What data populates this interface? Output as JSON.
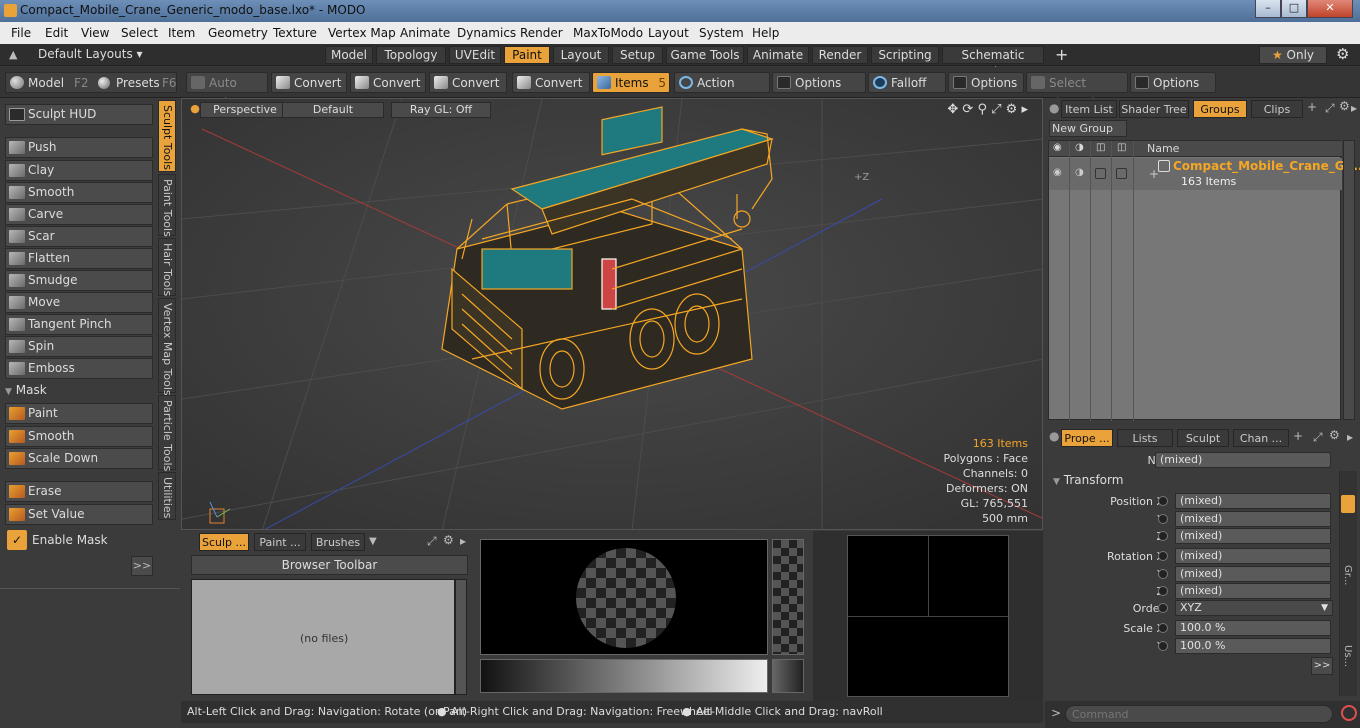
{
  "window": {
    "title": "Compact_Mobile_Crane_Generic_modo_base.lxo* - MODO"
  },
  "menu": [
    "File",
    "Edit",
    "View",
    "Select",
    "Item",
    "Geometry",
    "Texture",
    "Vertex Map",
    "Animate",
    "Dynamics",
    "Render",
    "MaxToModo",
    "Layout",
    "System",
    "Help"
  ],
  "layouts": {
    "label": "Default Layouts",
    "tabs": [
      "Model",
      "Topology",
      "UVEdit",
      "Paint",
      "Layout",
      "Setup",
      "Game Tools",
      "Animate",
      "Render",
      "Scripting",
      "Schematic Fusion"
    ],
    "active": "Paint",
    "only": "Only",
    "plus": "+"
  },
  "toolbar": {
    "model": "Model",
    "model_key": "F2",
    "presets": "Presets",
    "presets_key": "F6",
    "auto_select": "Auto Select",
    "convert1": "Convert",
    "convert2": "Convert",
    "convert3": "Convert",
    "convert4": "Convert",
    "items": "Items",
    "items_num": "5",
    "action_center": "Action Center",
    "options1": "Options",
    "falloff": "Falloff",
    "options2": "Options",
    "select_through": "Select Through",
    "options3": "Options"
  },
  "left": {
    "sculpt_hud": "Sculpt HUD",
    "tools": [
      "Push",
      "Clay",
      "Smooth",
      "Carve",
      "Scar",
      "Flatten",
      "Smudge",
      "Move",
      "Tangent Pinch",
      "Spin",
      "Emboss"
    ],
    "mask_header": "Mask",
    "mask_tools": [
      "Paint",
      "Smooth",
      "Scale Down"
    ],
    "erase": "Erase",
    "set_value": "Set Value",
    "enable_mask": "Enable Mask",
    "more": ">>",
    "vtabs": [
      "Sculpt Tools",
      "Paint Tools",
      "Hair Tools",
      "Vertex Map Tools",
      "Particle Tools",
      "Utilities"
    ]
  },
  "viewport": {
    "perspective": "Perspective",
    "default": "Default",
    "raygl": "Ray GL: Off",
    "axis_label": "+Z",
    "stats": {
      "items": "163 Items",
      "polygons": "Polygons : Face",
      "channels": "Channels: 0",
      "deformers": "Deformers: ON",
      "gl": "GL: 765,551",
      "size": "500 mm"
    }
  },
  "browser": {
    "tabs": [
      "Sculp ...",
      "Paint ...",
      "Brushes"
    ],
    "toolbar": "Browser Toolbar",
    "empty": "(no files)"
  },
  "status": {
    "text1": "Alt-Left Click and Drag: Navigation: Rotate (or Pan)",
    "text2": "Alt-Right Click and Drag: Navigation: Freewheel",
    "text3": "Alt-Middle Click and Drag: navRoll"
  },
  "rtop": {
    "tabs": [
      "Item List",
      "Shader Tree",
      "Groups",
      "Clips"
    ],
    "active": "Groups",
    "new_group": "New Group",
    "col_name": "Name",
    "group_name": "Compact_Mobile_Crane_G ...",
    "group_count": "163 Items"
  },
  "rbottom": {
    "tabs": [
      "Prope ...",
      "Lists",
      "Sculpt",
      "Chan ..."
    ],
    "name_label": "Name",
    "name_value": "(mixed)",
    "transform": "Transform",
    "pos_x": "Position X",
    "y": "Y",
    "z": "Z",
    "rot_x": "Rotation X",
    "order": "Order",
    "order_value": "XYZ",
    "scale_x": "Scale X",
    "mixed": "(mixed)",
    "scale_value": "100.0 %",
    "more": ">>",
    "side1": "Gr...",
    "side2": "Us..."
  },
  "command": {
    "placeholder": "Command",
    "prompt": ">"
  },
  "colors": {
    "accent": "#e9a33a",
    "wire": "#f5a623",
    "teal": "#1f7a7f"
  }
}
